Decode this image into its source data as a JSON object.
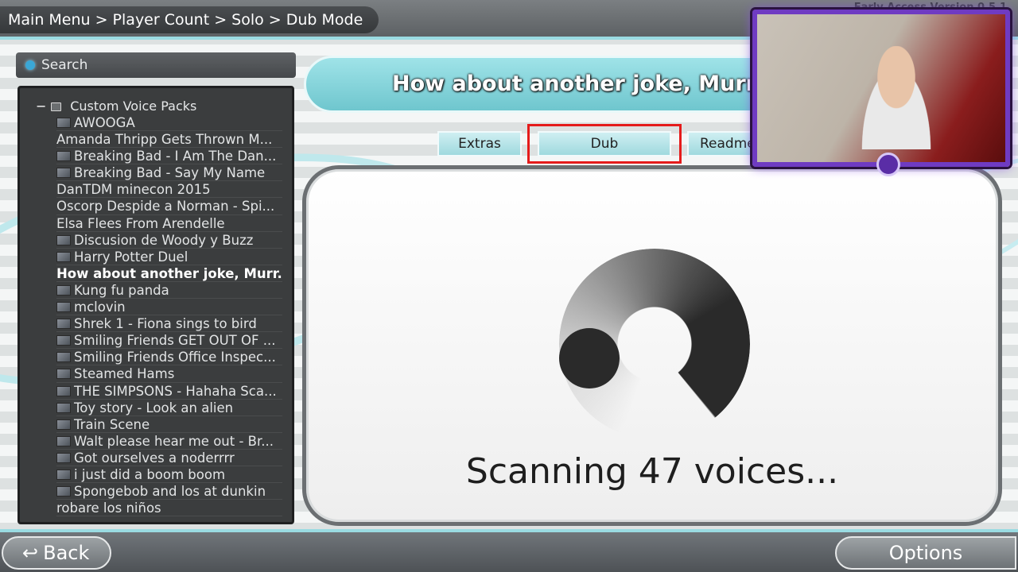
{
  "breadcrumb": "Main Menu > Player Count > Solo > Dub Mode",
  "version": "Early Access Version 0.5.1",
  "search": {
    "placeholder": "Search"
  },
  "tree": {
    "root_label": "Custom Voice Packs",
    "collapse_symbol": "−",
    "selected_index": 9,
    "items": [
      "AWOOGA",
      "Amanda Thripp Gets Thrown M...",
      "Breaking Bad - I Am The Dan...",
      "Breaking Bad - Say My Name",
      "DanTDM minecon 2015",
      "Oscorp Despide a Norman - Spi...",
      "Elsa Flees From Arendelle",
      "Discusion de Woody y Buzz",
      "Harry Potter Duel",
      "How about another joke, Murr...",
      "Kung fu panda",
      "mclovin",
      "Shrek 1 -  Fiona sings to bird",
      "Smiling Friends GET OUT OF ...",
      "Smiling Friends Office Inspec...",
      "Steamed Hams",
      "THE SIMPSONS - Hahaha Sca...",
      "Toy story - Look an alien",
      "Train Scene",
      "Walt please hear me out - Br...",
      "Got ourselves a noderrrr",
      "i just did a boom boom",
      "Spongebob and los at dunkin",
      "robare los niños"
    ],
    "thumb_flags": [
      true,
      false,
      true,
      true,
      false,
      false,
      false,
      true,
      true,
      false,
      true,
      true,
      true,
      true,
      true,
      true,
      true,
      true,
      true,
      true,
      true,
      true,
      true,
      false
    ]
  },
  "title": "How about another joke, Murray",
  "tabs": {
    "extras": "Extras",
    "dub": "Dub",
    "readme": "Readme"
  },
  "active_tab": "Dub",
  "scanning_text": "Scanning 47 voices...",
  "buttons": {
    "back": "Back",
    "back_icon": "↩",
    "options": "Options"
  },
  "colors": {
    "accent": "#9adbe2",
    "focus": "#e51b1b",
    "webcam_frame": "#6f3bc2"
  }
}
